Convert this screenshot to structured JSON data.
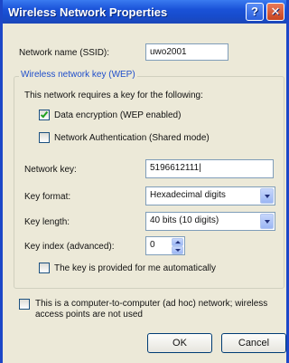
{
  "window": {
    "title": "Wireless Network Properties",
    "help_glyph": "?",
    "close_glyph": "✕"
  },
  "ssid": {
    "label": "Network name (SSID):",
    "value": "uwo2001"
  },
  "wep_group": {
    "legend": "Wireless network key (WEP)",
    "intro": "This network requires a key for the following:",
    "data_encryption": {
      "label": "Data encryption (WEP enabled)",
      "checked": true
    },
    "network_auth": {
      "label": "Network Authentication (Shared mode)",
      "checked": false
    },
    "network_key": {
      "label": "Network key:",
      "value": "5196612111"
    },
    "key_format": {
      "label": "Key format:",
      "value": "Hexadecimal digits"
    },
    "key_length": {
      "label": "Key length:",
      "value": "40 bits (10 digits)"
    },
    "key_index": {
      "label": "Key index (advanced):",
      "value": "0"
    },
    "auto_key": {
      "label": "The key is provided for me automatically",
      "checked": false
    }
  },
  "adhoc": {
    "label_line1": "This is a computer-to-computer (ad hoc) network; wireless",
    "label_line2": "access points are not used",
    "checked": false
  },
  "buttons": {
    "ok": "OK",
    "cancel": "Cancel"
  },
  "colors": {
    "title_bar": "#1a52d8",
    "group_legend": "#1f4ecb",
    "dialog_bg": "#ece9d8"
  }
}
